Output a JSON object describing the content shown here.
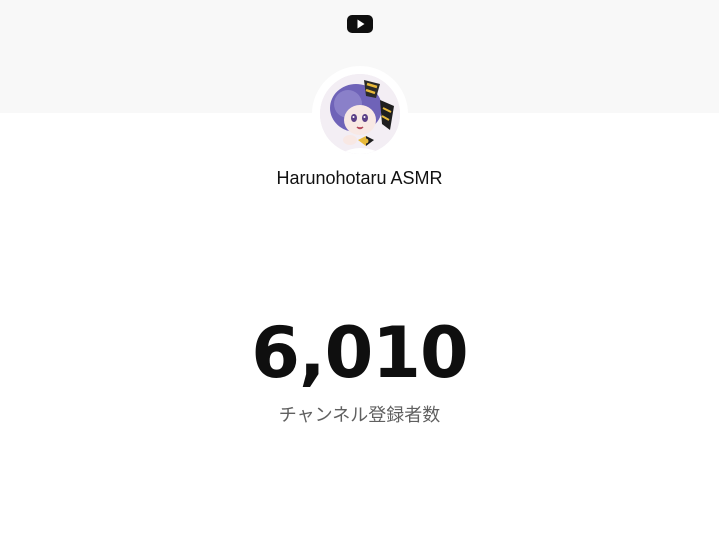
{
  "header": {
    "logo_icon": "youtube-logo-icon",
    "background_color": "#f8f8f8"
  },
  "channel": {
    "name": "Harunohotaru ASMR",
    "avatar_icon": "channel-avatar"
  },
  "subscribers": {
    "count": "6,010",
    "label": "チャンネル登録者数"
  }
}
